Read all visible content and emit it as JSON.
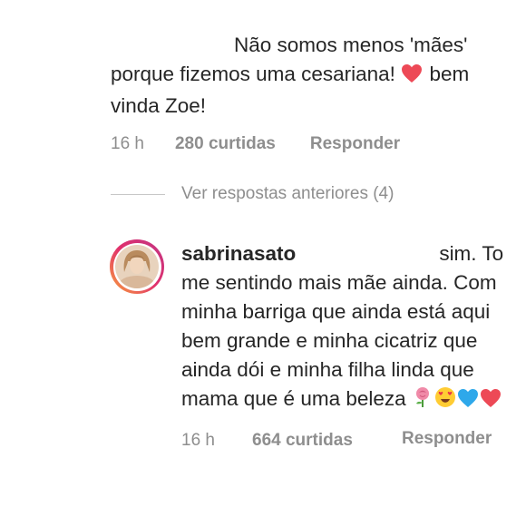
{
  "top_comment": {
    "text_line1": "Não somos menos 'mães'",
    "text_rest": "porque fizemos uma cesariana!",
    "text_end": "bem vinda Zoe!",
    "time": "16 h",
    "likes": "280 curtidas",
    "reply": "Responder"
  },
  "view_replies": {
    "label": "Ver respostas anteriores (4)"
  },
  "reply_comment": {
    "username": "sabrinasato",
    "text_first": "sim.",
    "text_body": "To me sentindo mais mãe ainda. Com minha barriga que ainda está aqui bem grande e minha cicatriz que ainda dói e minha filha linda que mama que é uma beleza",
    "time": "16 h",
    "likes": "664 curtidas",
    "reply": "Responder"
  },
  "colors": {
    "text": "#262626",
    "secondary": "#8e8e8e",
    "heart": "#ed4956",
    "blue_heart": "#2ea8ea"
  },
  "icons": [
    "red-heart-icon",
    "rose-icon",
    "heart-eyes-icon",
    "blue-heart-icon"
  ]
}
